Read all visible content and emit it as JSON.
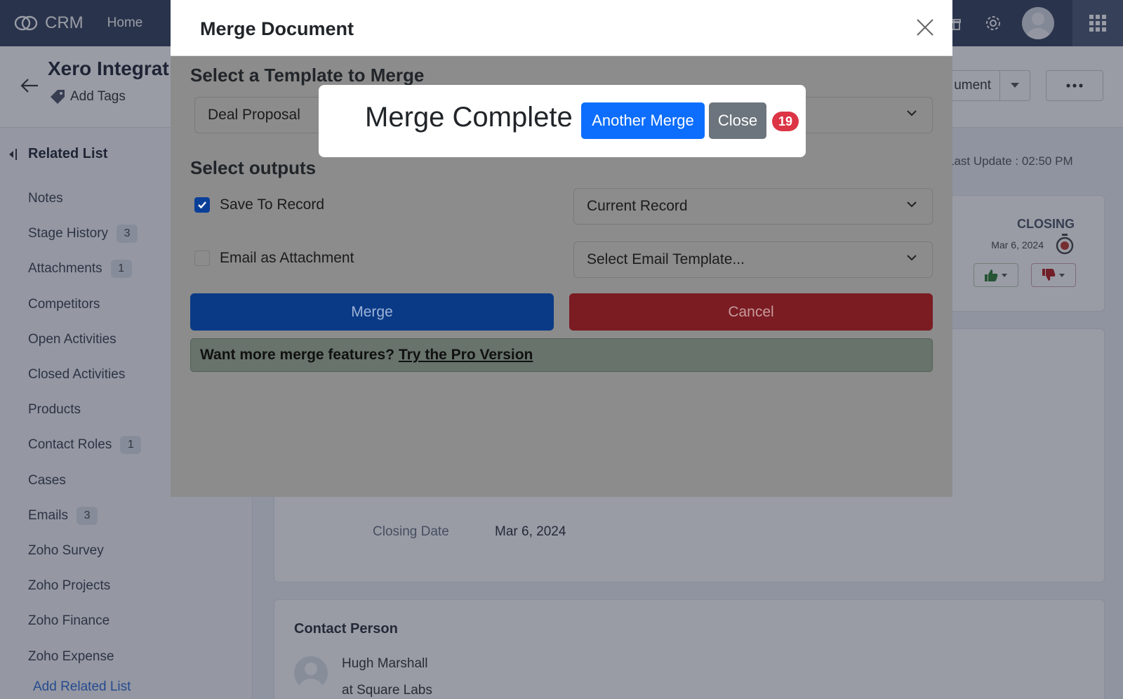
{
  "topbar": {
    "brand": "CRM",
    "nav_home": "Home"
  },
  "record": {
    "title": "Xero Integrat",
    "add_tags": "Add Tags",
    "document_button": "ument",
    "last_update": "Last Update : 02:50 PM"
  },
  "sidebar": {
    "heading": "Related List",
    "items": [
      {
        "label": "Notes",
        "badge": ""
      },
      {
        "label": "Stage History",
        "badge": "3"
      },
      {
        "label": "Attachments",
        "badge": "1"
      },
      {
        "label": "Competitors",
        "badge": ""
      },
      {
        "label": "Open Activities",
        "badge": ""
      },
      {
        "label": "Closed Activities",
        "badge": ""
      },
      {
        "label": "Products",
        "badge": ""
      },
      {
        "label": "Contact Roles",
        "badge": "1"
      },
      {
        "label": "Cases",
        "badge": ""
      },
      {
        "label": "Emails",
        "badge": "3"
      },
      {
        "label": "Zoho Survey",
        "badge": ""
      },
      {
        "label": "Zoho Projects",
        "badge": ""
      },
      {
        "label": "Zoho Finance",
        "badge": ""
      },
      {
        "label": "Zoho Expense",
        "badge": ""
      }
    ],
    "add_related": "Add Related List"
  },
  "stage": {
    "label": "CLOSING",
    "date": "Mar 6, 2024"
  },
  "details": {
    "closing_date_label": "Closing Date",
    "closing_date_value": "Mar 6, 2024"
  },
  "contact": {
    "title": "Contact Person",
    "name": "Hugh Marshall",
    "company": "at Square Labs"
  },
  "modal": {
    "title": "Merge Document",
    "template_heading": "Select a Template to Merge",
    "template_value": "Deal Proposal",
    "outputs_heading": "Select outputs",
    "save_to_record": "Save To Record",
    "save_to_record_checked": true,
    "save_target": "Current Record",
    "email_attachment": "Email as Attachment",
    "email_attachment_checked": false,
    "email_template": "Select Email Template...",
    "merge_button": "Merge",
    "cancel_button": "Cancel",
    "promo_text": "Want more merge features?",
    "promo_link": "Try the Pro Version"
  },
  "popup": {
    "title": "Merge Complete",
    "another_button": "Another Merge",
    "close_button": "Close",
    "count": "19"
  },
  "colors": {
    "topbar": "#34405c",
    "primary": "#0d6efd",
    "secondary": "#6c757d",
    "danger": "#dc3545",
    "merge_button": "#0a3a86",
    "cancel_button": "#7a1c22"
  }
}
